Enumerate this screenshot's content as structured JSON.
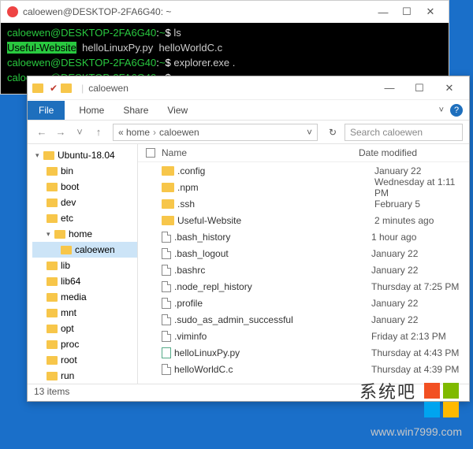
{
  "terminal": {
    "title": "caloewen@DESKTOP-2FA6G40: ~",
    "lines": {
      "l1_prompt": "caloewen@DESKTOP-2FA6G40",
      "l1_path": "~",
      "l1_cmd": "ls",
      "l2_hilite": "Useful-Website",
      "l2_rest": "  helloLinuxPy.py  helloWorldC.c",
      "l3_prompt": "caloewen@DESKTOP-2FA6G40",
      "l3_path": "~",
      "l3_cmd": "explorer.exe .",
      "l4_prompt": "caloewen@DESKTOP-2FA6G40",
      "l4_path": "~",
      "l4_cmd": ""
    }
  },
  "explorer": {
    "title": "caloewen",
    "ribbon": {
      "file": "File",
      "home": "Home",
      "share": "Share",
      "view": "View"
    },
    "addr": {
      "seg1": "« home",
      "seg2": "caloewen"
    },
    "refresh_glyph": "↻",
    "search_placeholder": "Search caloewen",
    "tree": {
      "root": "Ubuntu-18.04",
      "d0": "bin",
      "d1": "boot",
      "d2": "dev",
      "d3": "etc",
      "d4": "home",
      "d4a": "caloewen",
      "d5": "lib",
      "d6": "lib64",
      "d7": "media",
      "d8": "mnt",
      "d9": "opt",
      "d10": "proc",
      "d11": "root",
      "d12": "run"
    },
    "columns": {
      "name": "Name",
      "date": "Date modified"
    },
    "files": {
      "f0": {
        "n": ".config",
        "d": "January 22",
        "t": "folder"
      },
      "f1": {
        "n": ".npm",
        "d": "Wednesday at 1:11 PM",
        "t": "folder"
      },
      "f2": {
        "n": ".ssh",
        "d": "February 5",
        "t": "folder"
      },
      "f3": {
        "n": "Useful-Website",
        "d": "2 minutes ago",
        "t": "folder"
      },
      "f4": {
        "n": ".bash_history",
        "d": "1 hour ago",
        "t": "file"
      },
      "f5": {
        "n": ".bash_logout",
        "d": "January 22",
        "t": "file"
      },
      "f6": {
        "n": ".bashrc",
        "d": "January 22",
        "t": "file"
      },
      "f7": {
        "n": ".node_repl_history",
        "d": "Thursday at 7:25 PM",
        "t": "file"
      },
      "f8": {
        "n": ".profile",
        "d": "January 22",
        "t": "file"
      },
      "f9": {
        "n": ".sudo_as_admin_successful",
        "d": "January 22",
        "t": "file"
      },
      "f10": {
        "n": ".viminfo",
        "d": "Friday at 2:13 PM",
        "t": "file"
      },
      "f11": {
        "n": "helloLinuxPy.py",
        "d": "Thursday at 4:43 PM",
        "t": "py"
      },
      "f12": {
        "n": "helloWorldC.c",
        "d": "Thursday at 4:39 PM",
        "t": "file"
      }
    },
    "status": "13 items"
  },
  "watermark": {
    "brand": "系统吧",
    "url": "www.win7999.com"
  }
}
